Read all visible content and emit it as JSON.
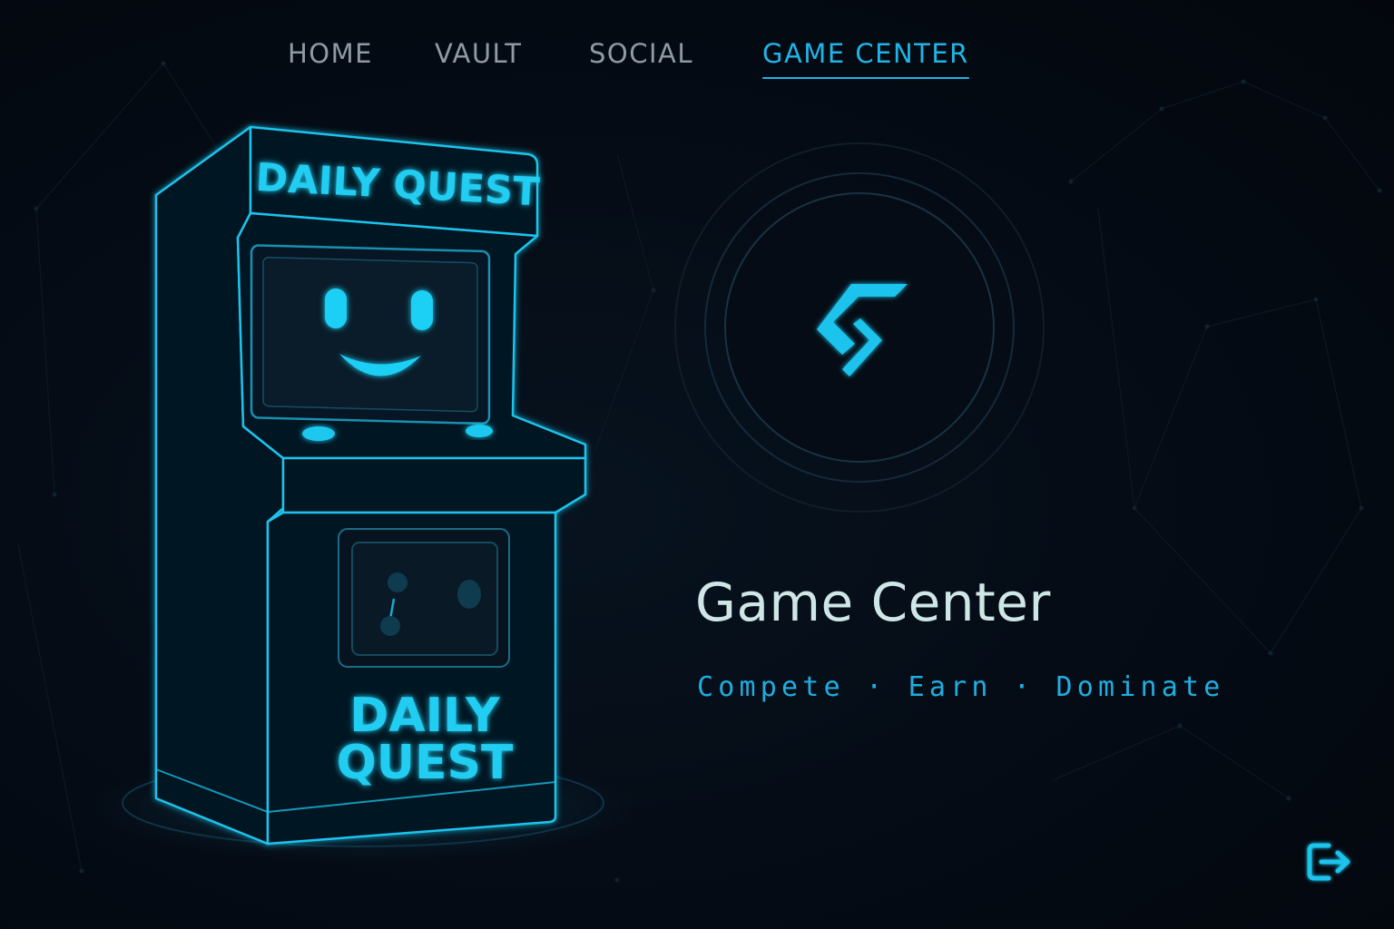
{
  "nav": {
    "items": [
      {
        "label": "HOME"
      },
      {
        "label": "VAULT"
      },
      {
        "label": "SOCIAL"
      },
      {
        "label": "GAME CENTER"
      }
    ],
    "active": "GAME CENTER"
  },
  "arcade": {
    "marquee_text": "DAILY QUEST",
    "front_line1": "DAILY",
    "front_line2": "QUEST"
  },
  "main": {
    "title": "Game Center",
    "tagline": "Compete · Earn · Dominate"
  },
  "icons": {
    "logo": "s-bolt-logo-icon",
    "exit": "exit-icon"
  },
  "colors": {
    "accent": "#1fb5e6",
    "background": "#040a12",
    "title": "#cfe6e6",
    "nav_inactive": "#8f9aa5"
  }
}
